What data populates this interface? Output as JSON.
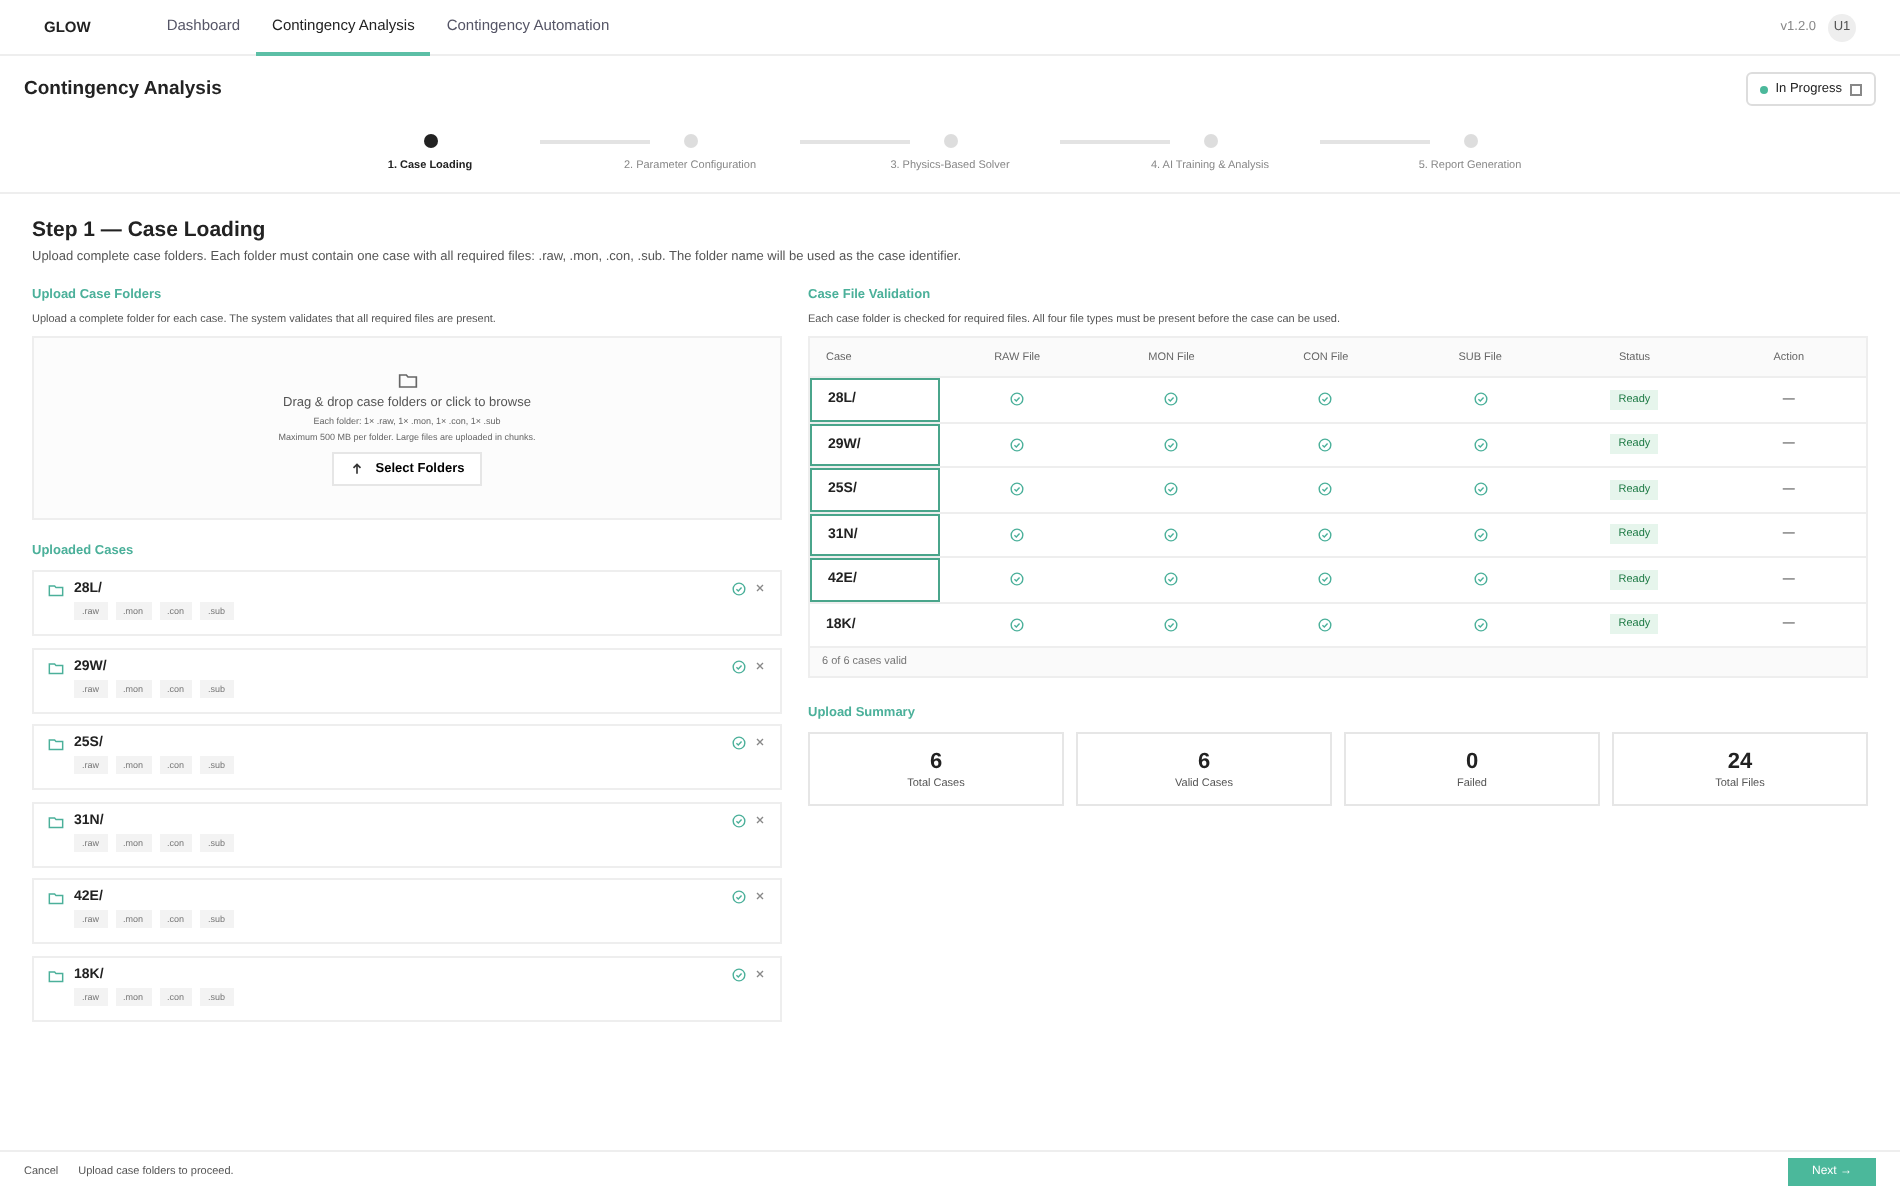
{
  "nav": {
    "logo": "GLOW",
    "tabs": [
      {
        "label": "Dashboard",
        "selected": false
      },
      {
        "label": "Contingency Analysis",
        "selected": true
      },
      {
        "label": "Contingency Automation",
        "selected": false
      }
    ],
    "version": "v1.2.0",
    "user": "U1"
  },
  "header": {
    "title": "Contingency Analysis",
    "status": "In Progress"
  },
  "steps": [
    {
      "label": "1. Case Loading",
      "current": true
    },
    {
      "label": "2. Parameter Configuration",
      "current": false
    },
    {
      "label": "3. Physics-Based Solver",
      "current": false
    },
    {
      "label": "4. AI Training & Analysis",
      "current": false
    },
    {
      "label": "5. Report Generation",
      "current": false
    }
  ],
  "step": {
    "title": "Step 1 — Case Loading",
    "description": "Upload complete case folders. Each folder must contain one case with all required files: .raw, .mon, .con, .sub. The folder name will be used as the case identifier."
  },
  "upload": {
    "title": "Upload Case Folders",
    "description": "Upload a complete folder for each case. The system validates that all required files are present.",
    "drop_title": "Drag & drop case folders or click to browse",
    "drop_hint": "Each folder: 1× .raw, 1× .mon, 1× .con, 1× .sub",
    "drop_limit": "Maximum 500 MB per folder. Large files are uploaded in chunks.",
    "button": "Select Folders"
  },
  "uploaded": {
    "title": "Uploaded Cases",
    "cases": [
      {
        "name": "28L/",
        "files": [
          ".raw",
          ".mon",
          ".con",
          ".sub"
        ]
      },
      {
        "name": "29W/",
        "files": [
          ".raw",
          ".mon",
          ".con",
          ".sub"
        ]
      },
      {
        "name": "25S/",
        "files": [
          ".raw",
          ".mon",
          ".con",
          ".sub"
        ]
      },
      {
        "name": "31N/",
        "files": [
          ".raw",
          ".mon",
          ".con",
          ".sub"
        ]
      },
      {
        "name": "42E/",
        "files": [
          ".raw",
          ".mon",
          ".con",
          ".sub"
        ]
      },
      {
        "name": "18K/",
        "files": [
          ".raw",
          ".mon",
          ".con",
          ".sub"
        ]
      }
    ]
  },
  "validation": {
    "title": "Case File Validation",
    "description": "Each case folder is checked for required files. All four file types must be present before the case can be used.",
    "columns": [
      "Case",
      "RAW File",
      "MON File",
      "CON File",
      "SUB File",
      "Status",
      "Action"
    ],
    "rows": [
      {
        "case": "28L/",
        "highlighted": true,
        "raw": true,
        "mon": true,
        "con": true,
        "sub": true,
        "status": "Ready",
        "action": "—"
      },
      {
        "case": "29W/",
        "highlighted": true,
        "raw": true,
        "mon": true,
        "con": true,
        "sub": true,
        "status": "Ready",
        "action": "—"
      },
      {
        "case": "25S/",
        "highlighted": true,
        "raw": true,
        "mon": true,
        "con": true,
        "sub": true,
        "status": "Ready",
        "action": "—"
      },
      {
        "case": "31N/",
        "highlighted": true,
        "raw": true,
        "mon": true,
        "con": true,
        "sub": true,
        "status": "Ready",
        "action": "—"
      },
      {
        "case": "42E/",
        "highlighted": true,
        "raw": true,
        "mon": true,
        "con": true,
        "sub": true,
        "status": "Ready",
        "action": "—"
      },
      {
        "case": "18K/",
        "highlighted": false,
        "raw": true,
        "mon": true,
        "con": true,
        "sub": true,
        "status": "Ready",
        "action": "—"
      }
    ],
    "footer": "6 of 6 cases valid"
  },
  "summary": {
    "title": "Upload Summary",
    "stats": [
      {
        "value": "6",
        "label": "Total Cases"
      },
      {
        "value": "6",
        "label": "Valid Cases"
      },
      {
        "value": "0",
        "label": "Failed"
      },
      {
        "value": "24",
        "label": "Total Files"
      }
    ]
  },
  "footer": {
    "cancel": "Cancel",
    "hint": "Upload case folders to proceed.",
    "next": "Next →"
  }
}
